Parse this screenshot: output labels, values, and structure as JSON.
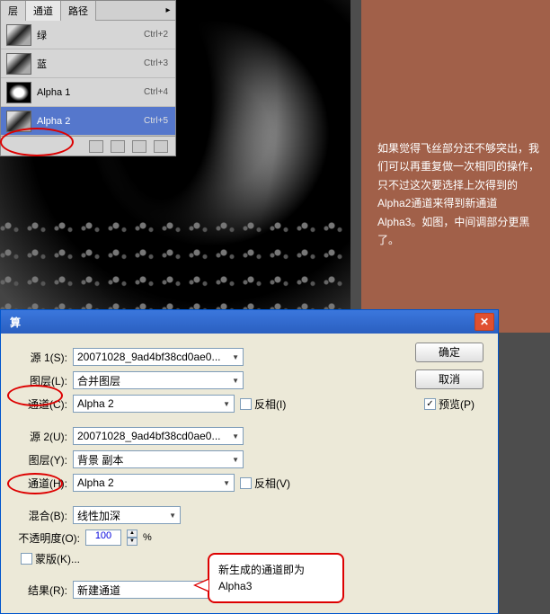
{
  "canvas": {},
  "sidebar_text": "如果觉得飞丝部分还不够突出，我们可以再重复做一次相同的操作，只不过这次要选择上次得到的Alpha2通道来得到新通道Alpha3。如图，中间调部分更黑了。",
  "channels_panel": {
    "tabs": [
      "层",
      "通道",
      "路径"
    ],
    "active_tab": 1,
    "rows": [
      {
        "name": "绿",
        "shortcut": "Ctrl+2",
        "selected": false
      },
      {
        "name": "蓝",
        "shortcut": "Ctrl+3",
        "selected": false
      },
      {
        "name": "Alpha 1",
        "shortcut": "Ctrl+4",
        "selected": false
      },
      {
        "name": "Alpha 2",
        "shortcut": "Ctrl+5",
        "selected": true
      }
    ]
  },
  "dialog": {
    "title": "算",
    "source1": {
      "label": "源 1(S):",
      "file": "20071028_9ad4bf38cd0ae0...",
      "layer_label": "图层(L):",
      "layer": "合并图层",
      "channel_label": "通道(C):",
      "channel": "Alpha 2",
      "invert_label": "反相(I)"
    },
    "source2": {
      "label": "源 2(U):",
      "file": "20071028_9ad4bf38cd0ae0...",
      "layer_label": "图层(Y):",
      "layer": "背景 副本",
      "channel_label": "通道(H):",
      "channel": "Alpha 2",
      "invert_label": "反相(V)"
    },
    "blend": {
      "label": "混合(B):",
      "mode": "线性加深"
    },
    "opacity": {
      "label": "不透明度(O):",
      "value": "100",
      "pct": "%"
    },
    "mask": {
      "label": "蒙版(K)..."
    },
    "result": {
      "label": "结果(R):",
      "value": "新建通道"
    },
    "buttons": {
      "ok": "确定",
      "cancel": "取消",
      "preview": "预览(P)"
    }
  },
  "callout": "新生成的通道即为Alpha3"
}
